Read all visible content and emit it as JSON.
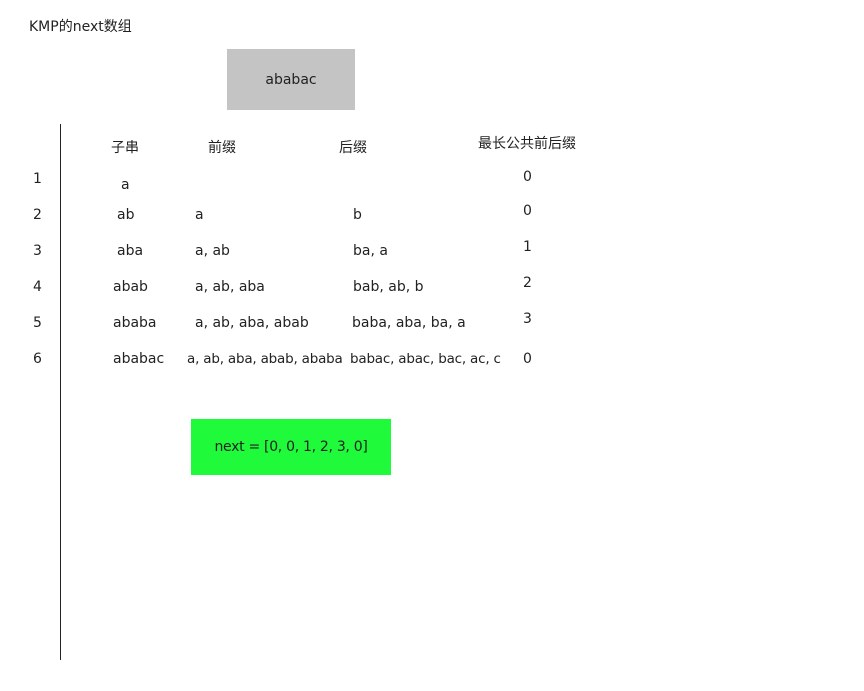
{
  "title": "KMP的next数组",
  "pattern": "ababac",
  "headers": {
    "substring": "子串",
    "prefix": "前缀",
    "suffix": "后缀",
    "lps": "最长公共前后缀"
  },
  "rows": [
    {
      "index": "1",
      "substring": "a",
      "prefixes": "",
      "suffixes": "",
      "value": "0"
    },
    {
      "index": "2",
      "substring": "ab",
      "prefixes": "a",
      "suffixes": "b",
      "value": "0"
    },
    {
      "index": "3",
      "substring": "aba",
      "prefixes": "a, ab",
      "suffixes": "ba, a",
      "value": "1"
    },
    {
      "index": "4",
      "substring": "abab",
      "prefixes": "a, ab, aba",
      "suffixes": "bab, ab, b",
      "value": "2"
    },
    {
      "index": "5",
      "substring": "ababa",
      "prefixes": "a, ab, aba, abab",
      "suffixes": "baba, aba, ba, a",
      "value": "3"
    },
    {
      "index": "6",
      "substring": "ababac",
      "prefixes": "a, ab, aba, abab, ababa",
      "suffixes": "babac, abac, bac, ac, c",
      "value": "0"
    }
  ],
  "result": "next = [0, 0, 1, 2, 3, 0]",
  "colors": {
    "pattern_box": "#c4c4c4",
    "result_box": "#1ffb3a"
  }
}
